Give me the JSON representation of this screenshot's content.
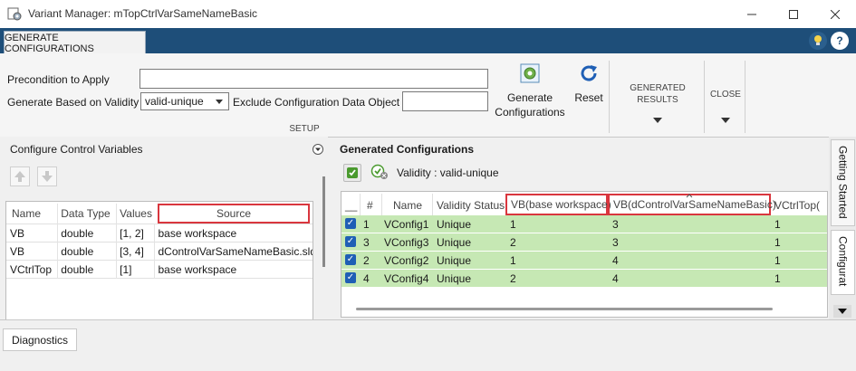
{
  "window": {
    "title": "Variant Manager: mTopCtrlVarSameNameBasic"
  },
  "ribbon": {
    "tab_label": "GENERATE CONFIGURATIONS"
  },
  "toolstrip": {
    "precondition_label": "Precondition to Apply",
    "precondition_value": "",
    "validity_label": "Generate Based on Validity",
    "validity_value": "valid-unique",
    "exclude_label": "Exclude Configuration Data Object",
    "exclude_value": "",
    "generate_button_label_1": "Generate",
    "generate_button_label_2": "Configurations",
    "reset_button_label": "Reset",
    "setup_section_label": "SETUP",
    "generated_results_label_1": "GENERATED",
    "generated_results_label_2": "RESULTS",
    "close_label": "CLOSE"
  },
  "left_panel": {
    "title": "Configure Control Variables",
    "columns": [
      "Name",
      "Data Type",
      "Values",
      "Source"
    ],
    "rows": [
      [
        "VB",
        "double",
        "[1, 2]",
        "base workspace"
      ],
      [
        "VB",
        "double",
        "[3, 4]",
        "dControlVarSameNameBasic.slddc"
      ],
      [
        "VCtrlTop",
        "double",
        "[1]",
        "base workspace"
      ]
    ]
  },
  "right_panel": {
    "title": "Generated Configurations",
    "validity_text": "Validity : valid-unique",
    "columns": [
      "__",
      "#",
      "Name",
      "Validity Status",
      "VB(base workspace)",
      "VB(dControlVarSameNameBasic)",
      "VCtrlTop("
    ],
    "rows": [
      [
        "1",
        "VConfig1",
        "Unique",
        "1",
        "3",
        "1"
      ],
      [
        "3",
        "VConfig3",
        "Unique",
        "2",
        "3",
        "1"
      ],
      [
        "2",
        "VConfig2",
        "Unique",
        "1",
        "4",
        "1"
      ],
      [
        "4",
        "VConfig4",
        "Unique",
        "2",
        "4",
        "1"
      ]
    ]
  },
  "side_tabs": {
    "getting_started": "Getting Started",
    "configurations": "Configurat"
  },
  "bottom": {
    "diagnostics_tab": "Diagnostics"
  },
  "colors": {
    "ribbon_blue": "#1e4e79",
    "row_green": "#c6e8b4",
    "highlight_red": "#d9363e",
    "checkbox_blue": "#1f5fb5"
  }
}
